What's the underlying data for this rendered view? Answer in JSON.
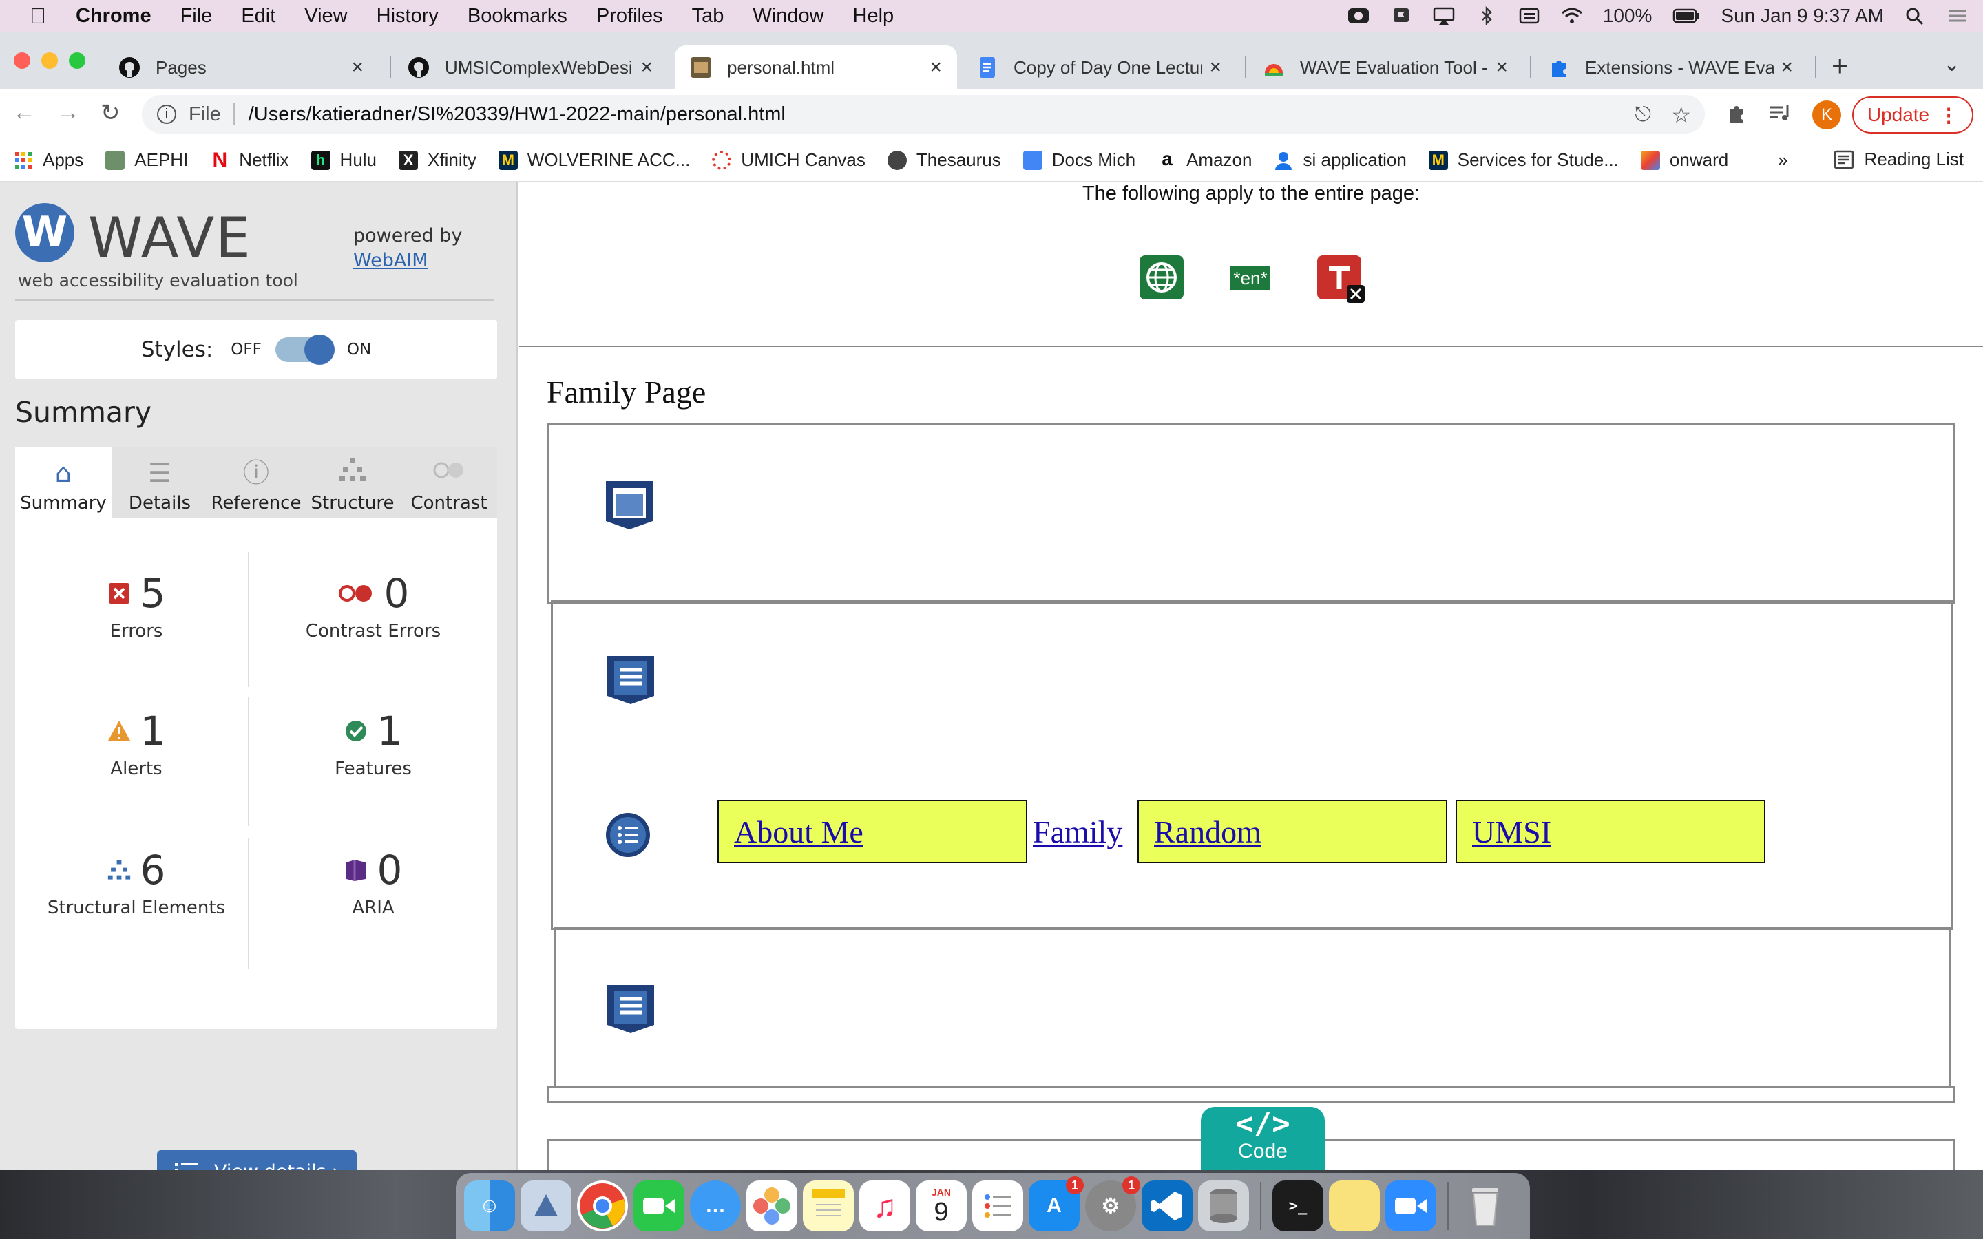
{
  "menubar": {
    "app_name": "Chrome",
    "items": [
      "File",
      "Edit",
      "View",
      "History",
      "Bookmarks",
      "Profiles",
      "Tab",
      "Window",
      "Help"
    ],
    "battery": "100%",
    "datetime": "Sun Jan 9  9:37 AM"
  },
  "tabs": [
    {
      "title": "Pages",
      "favicon": "github-icon"
    },
    {
      "title": "UMSIComplexWebDesign",
      "favicon": "github-icon"
    },
    {
      "title": "personal.html",
      "favicon": "image-icon",
      "active": true
    },
    {
      "title": "Copy of Day One Lecture",
      "favicon": "docs-icon"
    },
    {
      "title": "WAVE Evaluation Tool - C",
      "favicon": "webstore-icon"
    },
    {
      "title": "Extensions - WAVE Evalu",
      "favicon": "puzzle-icon"
    }
  ],
  "toolbar": {
    "scheme": "File",
    "url": "/Users/katieradner/SI%20339/HW1-2022-main/personal.html",
    "avatar_letter": "K",
    "update_label": "Update"
  },
  "bookmarks": [
    {
      "label": "Apps",
      "color": "#e94235"
    },
    {
      "label": "AEPHI",
      "color": "#6d8f6a"
    },
    {
      "label": "Netflix",
      "color": "#e50914"
    },
    {
      "label": "Hulu",
      "color": "#111111"
    },
    {
      "label": "Xfinity",
      "color": "#222222"
    },
    {
      "label": "WOLVERINE ACC...",
      "color": "#00274c"
    },
    {
      "label": "UMICH Canvas",
      "color": "#e23b2e"
    },
    {
      "label": "Thesaurus",
      "color": "#444444"
    },
    {
      "label": "Docs Mich",
      "color": "#4285f4"
    },
    {
      "label": "Amazon",
      "color": "#222222"
    },
    {
      "label": "si application",
      "color": "#1a73e8"
    },
    {
      "label": "Services for Stude...",
      "color": "#00274c"
    },
    {
      "label": "onward",
      "color": "#f4a41c"
    }
  ],
  "bookmarks_more": "»",
  "reading_list": "Reading List",
  "wave": {
    "logo_letter": "W",
    "name": "WAVE",
    "subtitle": "web accessibility evaluation tool",
    "powered_by": "powered by",
    "webaim": "WebAIM",
    "styles_label": "Styles:",
    "off": "OFF",
    "on": "ON",
    "summary_title": "Summary",
    "tabs": [
      "Summary",
      "Details",
      "Reference",
      "Structure",
      "Contrast"
    ],
    "stats": {
      "errors": {
        "value": "5",
        "label": "Errors"
      },
      "contrast": {
        "value": "0",
        "label": "Contrast Errors"
      },
      "alerts": {
        "value": "1",
        "label": "Alerts"
      },
      "features": {
        "value": "1",
        "label": "Features"
      },
      "structural": {
        "value": "6",
        "label": "Structural Elements"
      },
      "aria": {
        "value": "0",
        "label": "ARIA"
      }
    },
    "view_details": "View details ›"
  },
  "page": {
    "apply_text": "The following apply to the entire page:",
    "lang_badge": "*en*",
    "family_title": "Family Page",
    "nav_links": [
      "About Me",
      "Family",
      "Random",
      "UMSI"
    ],
    "code_label": "Code",
    "code_symbol": "</>"
  },
  "dock": {
    "calendar_month": "JAN",
    "calendar_day": "9",
    "badges": {
      "appstore": "1",
      "settings": "1"
    }
  }
}
